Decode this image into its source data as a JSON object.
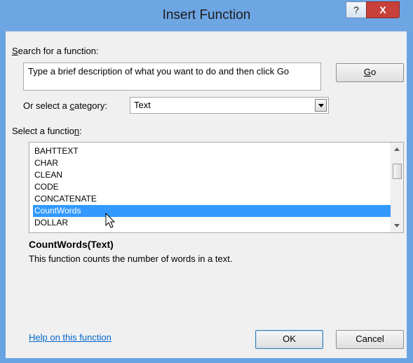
{
  "window": {
    "title": "Insert Function",
    "help_glyph": "?",
    "close_glyph": "X"
  },
  "search": {
    "label_pre": "",
    "label_u": "S",
    "label_post": "earch for a function:",
    "text": "Type a brief description of what you want to do and then click Go",
    "go_u": "G",
    "go_post": "o"
  },
  "category": {
    "label_pre": "Or select a ",
    "label_u": "c",
    "label_post": "ategory:",
    "value": "Text"
  },
  "functions": {
    "label_pre": "Select a functio",
    "label_u": "n",
    "label_post": ":",
    "items": [
      "BAHTTEXT",
      "CHAR",
      "CLEAN",
      "CODE",
      "CONCATENATE",
      "CountWords",
      "DOLLAR"
    ],
    "selected": "CountWords"
  },
  "detail": {
    "signature": "CountWords(Text)",
    "description": "This function counts the number of words in a text."
  },
  "footer": {
    "help_link": "Help on this function",
    "ok": "OK",
    "cancel": "Cancel"
  },
  "icons": {
    "cursor": "mouse-pointer-icon",
    "dropdown": "chevron-down-icon"
  }
}
